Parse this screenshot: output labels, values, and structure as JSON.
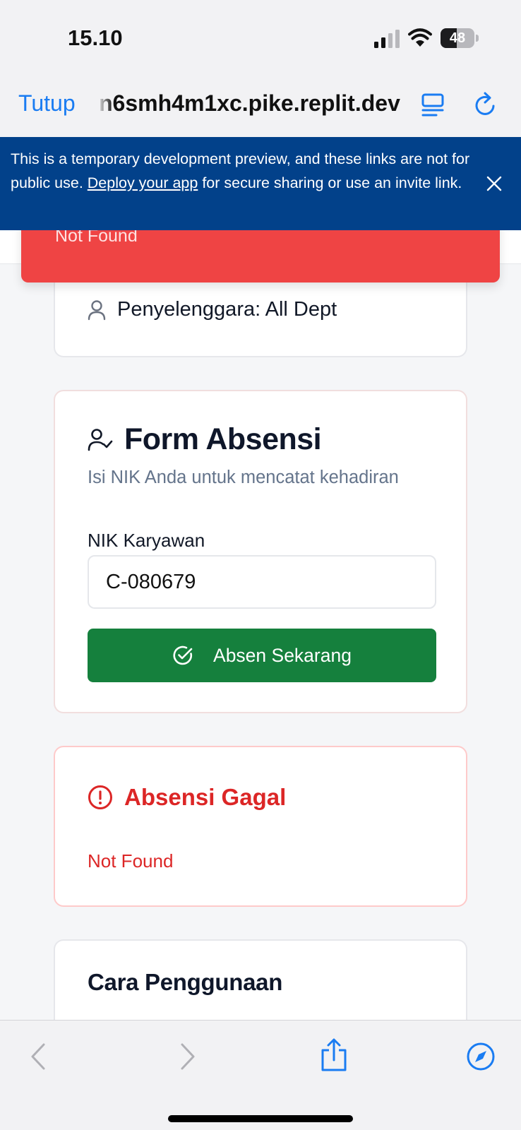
{
  "status_bar": {
    "time": "15.10",
    "battery_level": "48",
    "battery_fraction": 0.48
  },
  "browser": {
    "close_label": "Tutup",
    "url": "n6smh4m1xc.pike.replit.dev"
  },
  "dev_banner": {
    "text_before": "This is a temporary development preview, and these links are not for public use. ",
    "link_text": "Deploy your app",
    "text_after": " for secure sharing or use an invite link."
  },
  "toast": {
    "message": "Not Found"
  },
  "event_info": {
    "organizer": "Penyelenggara: All Dept"
  },
  "form": {
    "title": "Form Absensi",
    "subtitle": "Isi NIK Anda untuk mencatat kehadiran",
    "nik_label": "NIK Karyawan",
    "nik_value": "C-080679",
    "submit_label": "Absen Sekarang"
  },
  "error_card": {
    "title": "Absensi Gagal",
    "message": "Not Found"
  },
  "help_card": {
    "title": "Cara Penggunaan"
  },
  "colors": {
    "primary_green": "#15803d",
    "error_red": "#dc2626",
    "toast_red": "#ef4444",
    "banner_blue": "#02418a",
    "ios_blue": "#1a7cf2"
  },
  "icons": {
    "organizer": "user-icon",
    "form": "user-check-icon",
    "submit": "check-circle-icon",
    "error": "alert-circle-icon"
  }
}
